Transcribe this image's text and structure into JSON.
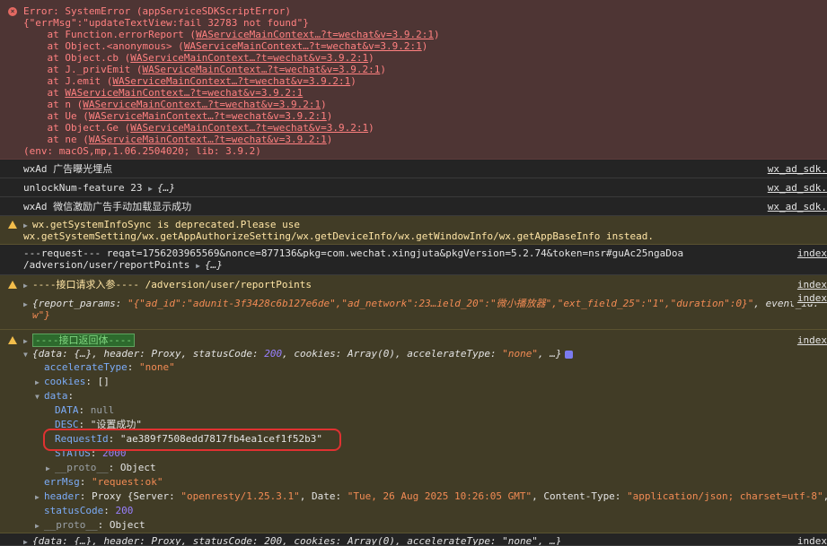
{
  "error": {
    "title": "Error: SystemError (appServiceSDKScriptError)",
    "errmsg": "{\"errMsg\":\"updateTextView:fail 32783 not found\"}",
    "stack": [
      {
        "prefix": "    at Function.errorReport (",
        "link": "WAServiceMainContext…?t=wechat&v=3.9.2:1",
        "suffix": ")"
      },
      {
        "prefix": "    at Object.<anonymous> (",
        "link": "WAServiceMainContext…?t=wechat&v=3.9.2:1",
        "suffix": ")"
      },
      {
        "prefix": "    at Object.cb (",
        "link": "WAServiceMainContext…?t=wechat&v=3.9.2:1",
        "suffix": ")"
      },
      {
        "prefix": "    at J._privEmit (",
        "link": "WAServiceMainContext…?t=wechat&v=3.9.2:1",
        "suffix": ")"
      },
      {
        "prefix": "    at J.emit (",
        "link": "WAServiceMainContext…?t=wechat&v=3.9.2:1",
        "suffix": ")"
      },
      {
        "prefix": "    at ",
        "link": "WAServiceMainContext…?t=wechat&v=3.9.2:1",
        "suffix": ""
      },
      {
        "prefix": "    at n (",
        "link": "WAServiceMainContext…?t=wechat&v=3.9.2:1",
        "suffix": ")"
      },
      {
        "prefix": "    at Ue (",
        "link": "WAServiceMainContext…?t=wechat&v=3.9.2:1",
        "suffix": ")"
      },
      {
        "prefix": "    at Object.Ge (",
        "link": "WAServiceMainContext…?t=wechat&v=3.9.2:1",
        "suffix": ")"
      },
      {
        "prefix": "    at ne (",
        "link": "WAServiceMainContext…?t=wechat&v=3.9.2:1",
        "suffix": ")"
      }
    ],
    "env": "(env: macOS,mp,1.06.2504020; lib: 3.9.2)"
  },
  "logs": {
    "ad_expose": "wxAd 广告曝光埋点",
    "ad_expose_src": "wx_ad_sdk.",
    "unlock_text": "unlockNum-feature 23 ",
    "unlock_obj": "{…}",
    "unlock_src": "wx_ad_sdk.",
    "ad_reward": "wxAd 微信激励广告手动加载显示成功",
    "ad_reward_src": "wx_ad_sdk."
  },
  "warn_deprecated": {
    "line1": "wx.getSystemInfoSync is deprecated.Please use",
    "line2": "wx.getSystemSetting/wx.getAppAuthorizeSetting/wx.getDeviceInfo/wx.getWindowInfo/wx.getAppBaseInfo instead."
  },
  "request_log": {
    "line1": "---request--- reqat=1756203965569&nonce=877136&pkg=com.wechat.xingjuta&pkgVersion=5.2.74&token=nsr#guAc25ngaDoa",
    "src": "index",
    "line2": "/adversion/user/reportPoints ",
    "obj": "{…}"
  },
  "warn_params": {
    "text": "----接口请求入参---- /adversion/user/reportPoints",
    "src": "index",
    "src2": "index",
    "obj_prefix": "{report_params: ",
    "obj_value": "\"{\"ad_id\":\"adunit-3f3428c6b127e6de\",\"ad_network\":23…ield_20\":\"微小播放器\",\"ext_field_25\":\"1\",\"duration\":0}\"",
    "obj_suffix": ", event_id:",
    "obj_line2": "w\"}"
  },
  "warn_response": {
    "badge": "----接口返回体----",
    "src": "index",
    "summary_pre": "{data: {…}, header: Proxy, statusCode: ",
    "summary_code": "200",
    "summary_mid": ", cookies: Array(0), accelerateType: ",
    "summary_str": "\"none\"",
    "summary_post": ", …}",
    "accelerate_key": "accelerateType",
    "accelerate_val": "\"none\"",
    "cookies_key": "cookies",
    "cookies_val": "[]",
    "data_key": "data",
    "DATA_key": "DATA",
    "DATA_val": "null",
    "DESC_key": "DESC",
    "DESC_val": "\"设置成功\"",
    "RequestId_key": "RequestId",
    "RequestId_val": "\"ae389f7508edd7817fb4ea1cef1f52b3\"",
    "STATUS_key": "STATUS",
    "STATUS_val": "2000",
    "proto_inner_key": "__proto__",
    "proto_inner_val": "Object",
    "errMsg_key": "errMsg",
    "errMsg_val": "\"request:ok\"",
    "header_key": "header",
    "header_pre": "Proxy {Server: ",
    "header_server": "\"openresty/1.25.3.1\"",
    "header_mid": ", Date: ",
    "header_date": "\"Tue, 26 Aug 2025 10:26:05 GMT\"",
    "header_mid2": ", Content-Type: ",
    "header_ct": "\"application/json; charset=utf-8\"",
    "header_post": ",",
    "statusCode_key": "statusCode",
    "statusCode_val": "200",
    "proto_outer_key": "__proto__",
    "proto_outer_val": "Object"
  },
  "last_row": {
    "text": "{data: {…}, header: Proxy, statusCode: 200, cookies: Array(0), accelerateType: \"none\", …}",
    "src": "index"
  },
  "colors": {
    "highlight_box": "#e03131",
    "error_bg": "#4e3534",
    "warn_bg": "#413c26"
  }
}
